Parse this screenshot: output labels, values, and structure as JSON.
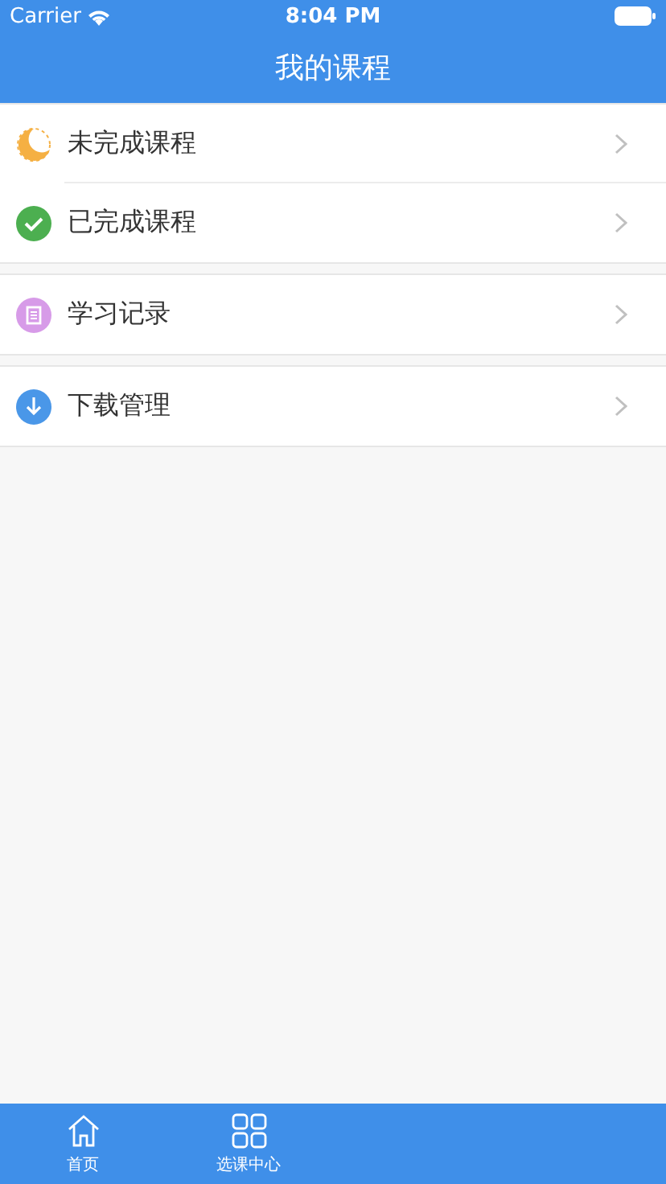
{
  "status_bar": {
    "carrier": "Carrier",
    "time": "8:04 PM"
  },
  "nav": {
    "title": "我的课程"
  },
  "groups": [
    {
      "items": [
        {
          "label": "未完成课程"
        },
        {
          "label": "已完成课程"
        }
      ]
    },
    {
      "items": [
        {
          "label": "学习记录"
        }
      ]
    },
    {
      "items": [
        {
          "label": "下载管理"
        }
      ]
    }
  ],
  "tab_bar": [
    {
      "label": "首页"
    },
    {
      "label": "选课中心"
    }
  ]
}
